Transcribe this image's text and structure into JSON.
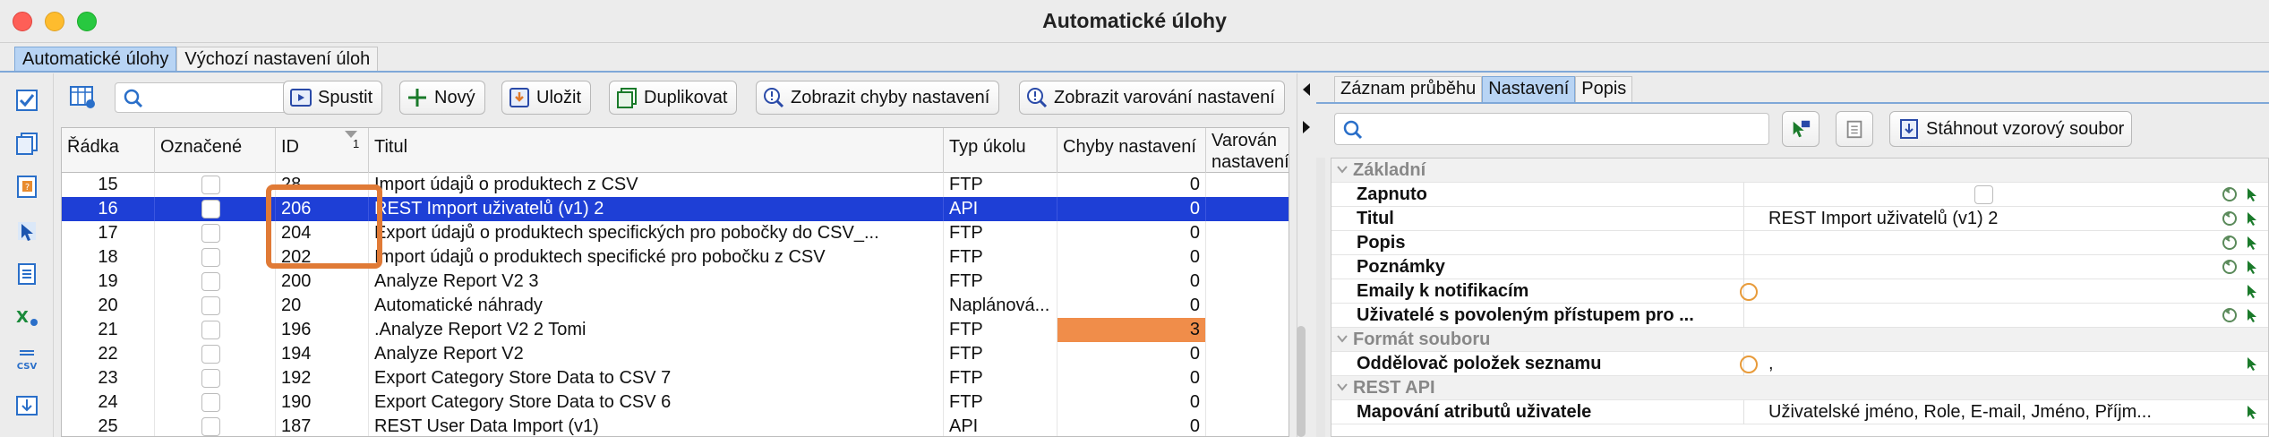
{
  "window": {
    "title": "Automatické úlohy"
  },
  "top_tabs": [
    {
      "label": "Automatické úlohy",
      "active": true
    },
    {
      "label": "Výchozí nastavení úloh",
      "active": false
    }
  ],
  "toolbar": {
    "search_placeholder": "",
    "run_label": "Spustit",
    "new_label": "Nový",
    "save_label": "Uložit",
    "duplicate_label": "Duplikovat",
    "show_errors_label": "Zobrazit chyby nastavení",
    "show_warnings_label": "Zobrazit varování nastavení"
  },
  "table": {
    "columns": {
      "radka": "Řádka",
      "oznacene": "Označené",
      "id": "ID",
      "id_sort": "1",
      "titul": "Titul",
      "typ": "Typ úkolu",
      "chyby": "Chyby nastavení",
      "varovani": "Varován nastavení"
    },
    "rows": [
      {
        "radka": "15",
        "id": "28",
        "titul": "Import údajů o produktech z CSV",
        "typ": "FTP",
        "chyby": "0",
        "selected": false,
        "error": false
      },
      {
        "radka": "16",
        "id": "206",
        "titul": "REST Import uživatelů (v1) 2",
        "typ": "API",
        "chyby": "0",
        "selected": true,
        "error": false
      },
      {
        "radka": "17",
        "id": "204",
        "titul": "Export údajů o produktech specifických pro pobočky do CSV_...",
        "typ": "FTP",
        "chyby": "0",
        "selected": false,
        "error": false
      },
      {
        "radka": "18",
        "id": "202",
        "titul": "Import údajů o produktech specifické pro pobočku z CSV",
        "typ": "FTP",
        "chyby": "0",
        "selected": false,
        "error": false
      },
      {
        "radka": "19",
        "id": "200",
        "titul": "Analyze Report V2 3",
        "typ": "FTP",
        "chyby": "0",
        "selected": false,
        "error": false
      },
      {
        "radka": "20",
        "id": "20",
        "titul": "Automatické náhrady",
        "typ": "Naplánová...",
        "chyby": "0",
        "selected": false,
        "error": false
      },
      {
        "radka": "21",
        "id": "196",
        "titul": ".Analyze Report V2 2 Tomi",
        "typ": "FTP",
        "chyby": "3",
        "selected": false,
        "error": true
      },
      {
        "radka": "22",
        "id": "194",
        "titul": "Analyze Report V2",
        "typ": "FTP",
        "chyby": "0",
        "selected": false,
        "error": false
      },
      {
        "radka": "23",
        "id": "192",
        "titul": "Export Category Store Data to CSV 7",
        "typ": "FTP",
        "chyby": "0",
        "selected": false,
        "error": false
      },
      {
        "radka": "24",
        "id": "190",
        "titul": "Export Category Store Data to CSV 6",
        "typ": "FTP",
        "chyby": "0",
        "selected": false,
        "error": false
      },
      {
        "radka": "25",
        "id": "187",
        "titul": "REST User Data Import (v1)",
        "typ": "API",
        "chyby": "0",
        "selected": false,
        "error": false
      }
    ]
  },
  "right_tabs": [
    {
      "label": "Záznam průběhu",
      "active": false
    },
    {
      "label": "Nastavení",
      "active": true
    },
    {
      "label": "Popis",
      "active": false
    }
  ],
  "right_toolbar": {
    "search_placeholder": "",
    "download_label": "Stáhnout vzorový soubor"
  },
  "properties": [
    {
      "kind": "group",
      "label": "Základní"
    },
    {
      "kind": "prop",
      "label": "Zapnuto",
      "value": "",
      "checkbox": true,
      "marker": false
    },
    {
      "kind": "prop",
      "label": "Titul",
      "value": "REST Import uživatelů (v1) 2",
      "checkbox": false,
      "marker": false
    },
    {
      "kind": "prop",
      "label": "Popis",
      "value": "",
      "checkbox": false,
      "marker": false
    },
    {
      "kind": "prop",
      "label": "Poznámky",
      "value": "",
      "checkbox": false,
      "marker": false
    },
    {
      "kind": "prop",
      "label": "Emaily k notifikacím",
      "value": "",
      "checkbox": false,
      "marker": true
    },
    {
      "kind": "prop",
      "label": "Uživatelé s povoleným přístupem pro ...",
      "value": "",
      "checkbox": false,
      "marker": false
    },
    {
      "kind": "group",
      "label": "Formát souboru"
    },
    {
      "kind": "prop",
      "label": "Oddělovač položek seznamu",
      "value": ",",
      "checkbox": false,
      "marker": true
    },
    {
      "kind": "group",
      "label": "REST API"
    },
    {
      "kind": "prop",
      "label": "Mapování atributů uživatele",
      "value": "Uživatelské jméno, Role, E-mail, Jméno, Příjm...",
      "checkbox": false,
      "marker": false
    }
  ],
  "colors": {
    "selection": "#1e3fd6",
    "error_cell": "#f08d4a",
    "highlight_box": "#e07a36",
    "active_tab": "#b8d4f4"
  }
}
